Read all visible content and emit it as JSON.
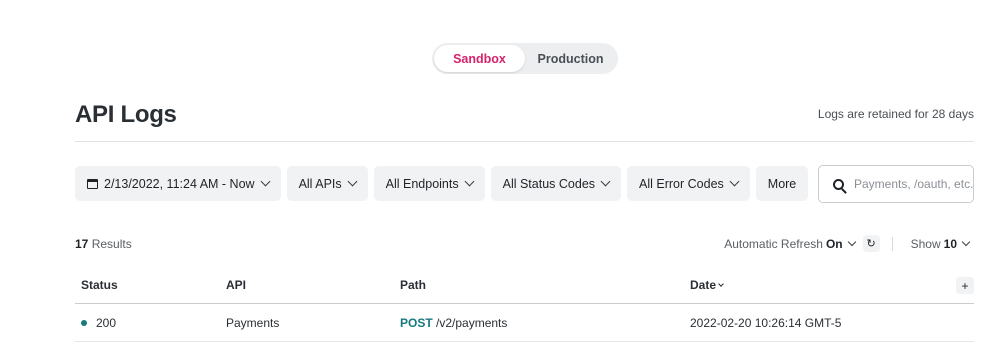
{
  "environment": {
    "options": [
      "Sandbox",
      "Production"
    ],
    "active": "Sandbox",
    "accent_color": "#d6226b"
  },
  "header": {
    "title": "API Logs",
    "retention_note": "Logs are retained for 28 days"
  },
  "filters": {
    "date_range": "2/13/2022, 11:24 AM - Now",
    "apis": "All APIs",
    "endpoints": "All Endpoints",
    "status_codes": "All Status Codes",
    "error_codes": "All Error Codes",
    "more": "More"
  },
  "search": {
    "placeholder": "Payments, /oauth, etc.",
    "value": ""
  },
  "summary": {
    "count": "17",
    "label": "Results"
  },
  "controls": {
    "auto_refresh_label": "Automatic Refresh",
    "auto_refresh_value": "On",
    "show_label": "Show",
    "show_value": "10"
  },
  "table": {
    "columns": [
      "Status",
      "API",
      "Path",
      "Date"
    ],
    "add_column_label": "+",
    "rows": [
      {
        "status": "200",
        "status_color": "#167a7c",
        "api": "Payments",
        "method": "POST",
        "path": "/v2/payments",
        "date": "2022-02-20 10:26:14 GMT-5"
      }
    ]
  },
  "icons": {
    "calendar": "calendar-icon",
    "search": "search-icon",
    "refresh": "refresh-icon",
    "chevron": "chevron-down-icon"
  }
}
